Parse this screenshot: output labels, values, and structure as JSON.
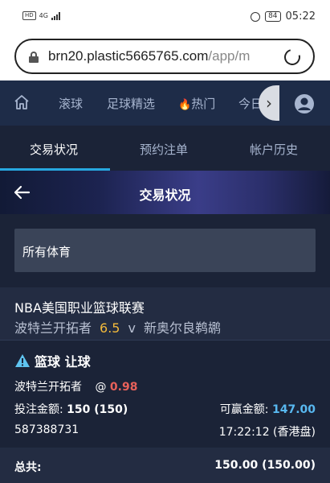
{
  "status_bar": {
    "hd": "HD",
    "network": "4G",
    "battery": "84",
    "time": "05:22"
  },
  "browser": {
    "url_host": "brn20.plastic5665765.com",
    "url_path": "/app/m"
  },
  "nav": {
    "items": [
      "滚球",
      "足球精选",
      "热门",
      "今日"
    ],
    "icons": [
      "home-icon",
      "fire-icon",
      "chevron-right-icon",
      "user-icon"
    ]
  },
  "tabs": {
    "items": [
      "交易状况",
      "预约注单",
      "帐户历史"
    ],
    "active_index": 0
  },
  "page": {
    "title": "交易状况"
  },
  "filter": {
    "value": "所有体育"
  },
  "league": {
    "name": "NBA美国职业篮球联赛",
    "home": "波特兰开拓者",
    "handicap": "6.5",
    "vs": "v",
    "away": "新奥尔良鹈鹕"
  },
  "bet": {
    "market": "篮球 让球",
    "selection": "波特兰开拓者",
    "at": "@",
    "odds": "0.98",
    "stake_label": "投注金额:",
    "stake": "150 (150)",
    "win_label": "可赢金额:",
    "win": "147.00",
    "ticket_id": "587388731",
    "time": "17:22:12 (香港盘)"
  },
  "total": {
    "label": "总共:",
    "value": "150.00 (150.00)"
  },
  "colors": {
    "accent": "#27a8e0",
    "odds": "#e8615a",
    "handicap": "#f2b93b",
    "win": "#58b8f0",
    "nav_bg": "#1e2c48",
    "page_bg": "#1b2337"
  }
}
